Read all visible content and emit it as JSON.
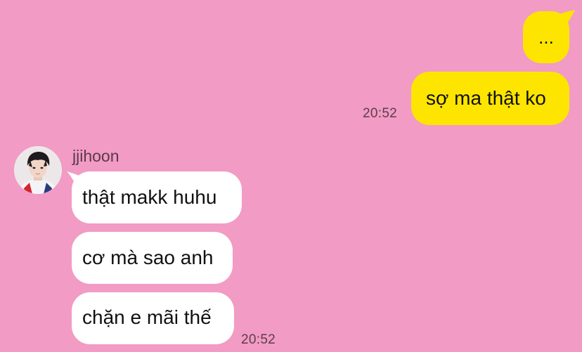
{
  "outgoing": {
    "messages": [
      {
        "text": "..."
      },
      {
        "text": "sợ ma thật ko"
      }
    ],
    "time": "20:52"
  },
  "incoming": {
    "sender": "jjihoon",
    "messages": [
      {
        "text": "thật makk huhu"
      },
      {
        "text": "cơ mà sao anh"
      },
      {
        "text": "chặn e mãi thế"
      }
    ],
    "time": "20:52"
  },
  "colors": {
    "background": "#f29bc4",
    "outgoing_bubble": "#fde500",
    "incoming_bubble": "#ffffff"
  },
  "icons": {
    "avatar": "profile-photo-avatar"
  }
}
